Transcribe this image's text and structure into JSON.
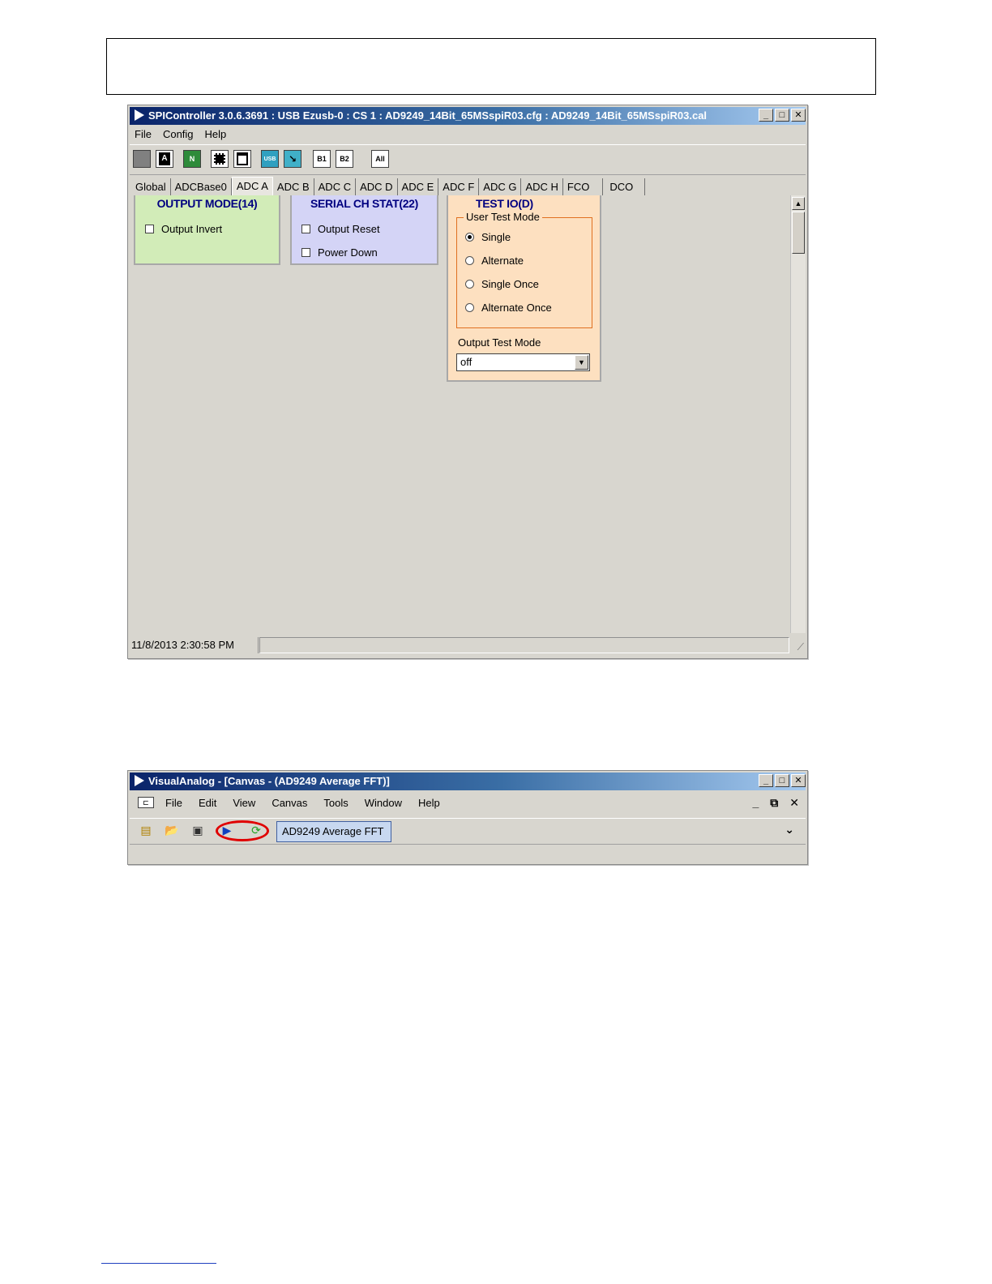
{
  "spi": {
    "title": "SPIController 3.0.6.3691 : USB Ezusb-0 : CS 1 : AD9249_14Bit_65MSspiR03.cfg : AD9249_14Bit_65MSspiR03.cal",
    "menu": [
      "File",
      "Config",
      "Help"
    ],
    "toolbar": {
      "n_label": "N",
      "usb_label": "USB",
      "b1_label": "B1",
      "b2_label": "B2",
      "all_label": "All"
    },
    "tabs": [
      "Global",
      "ADCBase0",
      "ADC A",
      "ADC B",
      "ADC C",
      "ADC D",
      "ADC E",
      "ADC F",
      "ADC G",
      "ADC H",
      "FCO",
      "DCO"
    ],
    "active_tab": "ADC A",
    "panels": {
      "output_mode": {
        "title": "OUTPUT MODE(14)",
        "output_invert": "Output Invert"
      },
      "serial_ch_stat": {
        "title": "SERIAL CH STAT(22)",
        "output_reset": "Output Reset",
        "power_down": "Power Down"
      },
      "test_io": {
        "title": "TEST IO(D)",
        "group_label": "User Test Mode",
        "options": [
          "Single",
          "Alternate",
          "Single Once",
          "Alternate Once"
        ],
        "selected": "Single",
        "output_test_mode_label": "Output Test Mode",
        "output_test_mode_value": "off"
      }
    },
    "status": "11/8/2013 2:30:58 PM",
    "colors": {
      "output_mode_bg": "#d2ecb8",
      "serial_bg": "#d4d4f6",
      "test_io_bg": "#fde0c0"
    }
  },
  "va": {
    "title": "VisualAnalog - [Canvas - (AD9249 Average FFT)]",
    "menu": [
      "File",
      "Edit",
      "View",
      "Canvas",
      "Tools",
      "Window",
      "Help"
    ],
    "canvas_button": "AD9249 Average FFT",
    "icons": [
      "new-canvas-icon",
      "open-folder-icon",
      "save-icon",
      "run-icon",
      "continuous-run-icon"
    ]
  }
}
